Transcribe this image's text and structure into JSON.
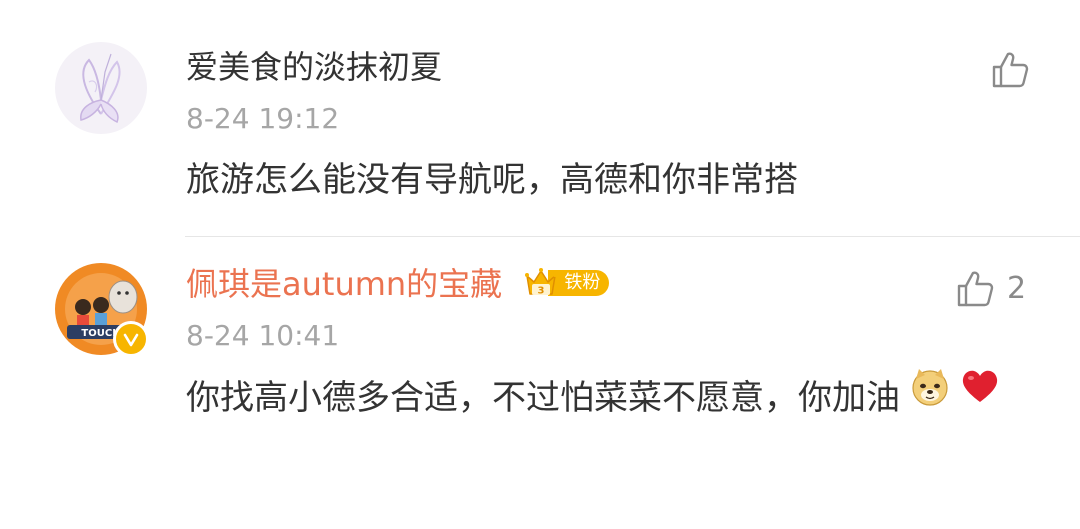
{
  "comments": [
    {
      "username": "爱美食的淡抹初夏",
      "time": "8-24 19:12",
      "text": "旅游怎么能没有导航呢，高德和你非常搭",
      "like_count": "",
      "avatar_icon": "butterfly-icon"
    },
    {
      "username": "佩琪是autumn的宝藏",
      "badge_label": "铁粉",
      "badge_level": "3",
      "time": "8-24 10:41",
      "text": "你找高小德多合适，不过怕菜菜不愿意，你加油",
      "like_count": "2",
      "avatar_icon": "touch-cartoon-icon",
      "emojis": [
        "doge-icon",
        "red-heart-icon"
      ]
    }
  ],
  "colors": {
    "username_default": "#333333",
    "username_vip": "#eb7350",
    "timestamp": "#a6a6a6",
    "badge": "#f7b500",
    "heart": "#e0202f"
  }
}
